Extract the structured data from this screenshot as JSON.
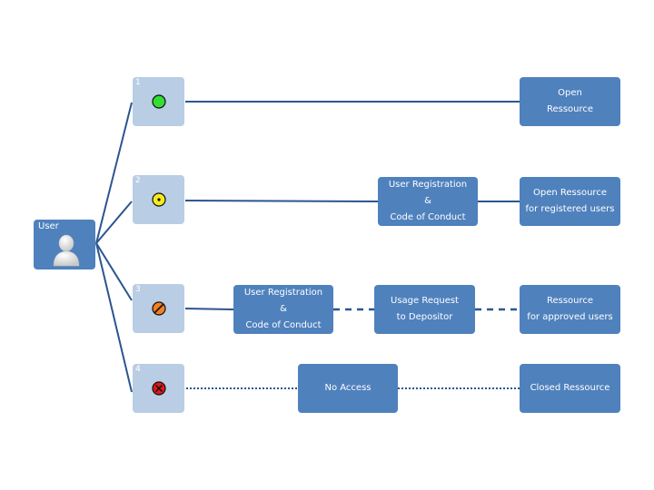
{
  "user": {
    "label": "User",
    "icon": "user-avatar-icon"
  },
  "colors": {
    "box_fill": "#4f81bd",
    "level_fill": "#b9cde5",
    "line": "#2c5590",
    "green": "#33dd33",
    "yellow": "#f5ec1e",
    "orange": "#f57f1f",
    "red": "#e01818"
  },
  "levels": [
    {
      "number": "1",
      "indicator": "green-circle-icon",
      "steps": [],
      "result": {
        "line1": "Open",
        "line2": "Ressource"
      },
      "connector": "solid"
    },
    {
      "number": "2",
      "indicator": "yellow-dot-circle-icon",
      "steps": [
        {
          "line1": "User Registration",
          "line2": "&",
          "line3": "Code of Conduct"
        }
      ],
      "result": {
        "line1": "Open Ressource",
        "line2": "for registered users"
      },
      "connector": "solid"
    },
    {
      "number": "3",
      "indicator": "orange-prohibited-icon",
      "steps": [
        {
          "line1": "User Registration",
          "line2": "&",
          "line3": "Code of Conduct"
        },
        {
          "line1": "Usage Request",
          "line2": "to Depositor"
        }
      ],
      "result": {
        "line1": "Ressource",
        "line2": "for approved users"
      },
      "connector": "dashed"
    },
    {
      "number": "4",
      "indicator": "red-x-circle-icon",
      "steps": [
        {
          "line1": "No Access"
        }
      ],
      "result": {
        "line1": "Closed Ressource"
      },
      "connector": "dotted"
    }
  ]
}
